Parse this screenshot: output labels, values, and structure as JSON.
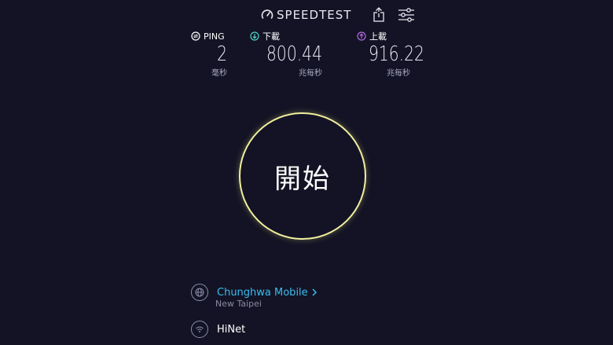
{
  "app": {
    "brand": "SPEEDTEST"
  },
  "metrics": {
    "ping": {
      "label": "PING",
      "value": "2",
      "unit": "毫秒"
    },
    "download": {
      "label": "下載",
      "value": "800.44",
      "unit": "兆每秒"
    },
    "upload": {
      "label": "上載",
      "value": "916.22",
      "unit": "兆每秒"
    }
  },
  "go_button": {
    "label": "開始"
  },
  "provider": {
    "name": "Chunghwa Mobile",
    "location": "New Taipei"
  },
  "host": {
    "name": "HiNet"
  },
  "colors": {
    "background": "#131325",
    "ring": "#f2ef9f",
    "download_accent": "#4fd1c5",
    "upload_accent": "#b46be0",
    "link": "#38bdf0"
  },
  "icons": {
    "brand": "gauge-icon",
    "share": "share-icon",
    "settings": "sliders-icon",
    "ping": "ping-icon",
    "download": "download-arrow-icon",
    "upload": "upload-arrow-icon",
    "provider": "globe-icon",
    "host": "wifi-icon"
  }
}
